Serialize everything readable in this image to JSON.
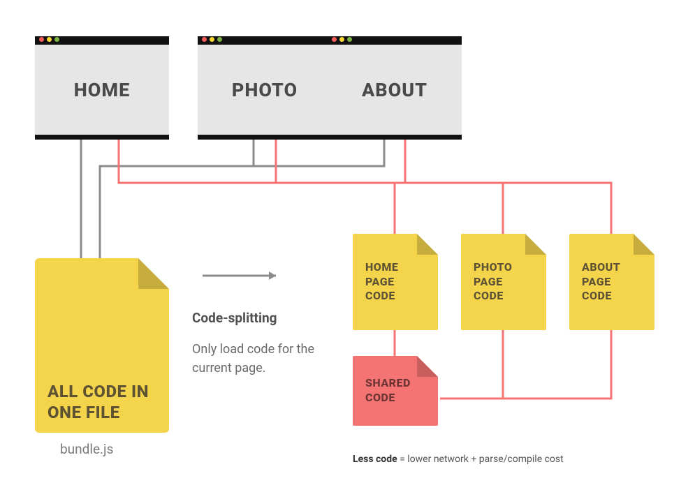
{
  "windows": {
    "home": "HOME",
    "photo": "PHOTO",
    "about": "ABOUT"
  },
  "bundle": {
    "label": "ALL CODE IN ONE FILE",
    "filename": "bundle.js"
  },
  "center": {
    "heading": "Code-splitting",
    "body": "Only load code for the current page."
  },
  "chunks": {
    "home": "HOME PAGE CODE",
    "photo": "PHOTO PAGE CODE",
    "about": "ABOUT PAGE CODE",
    "shared": "SHARED CODE"
  },
  "footnote": {
    "bold": "Less code",
    "rest": " = lower network + parse/compile cost"
  },
  "colors": {
    "gray_line": "#8b8b8b",
    "red_line": "#f47373",
    "yellow": "#f3d44b"
  }
}
